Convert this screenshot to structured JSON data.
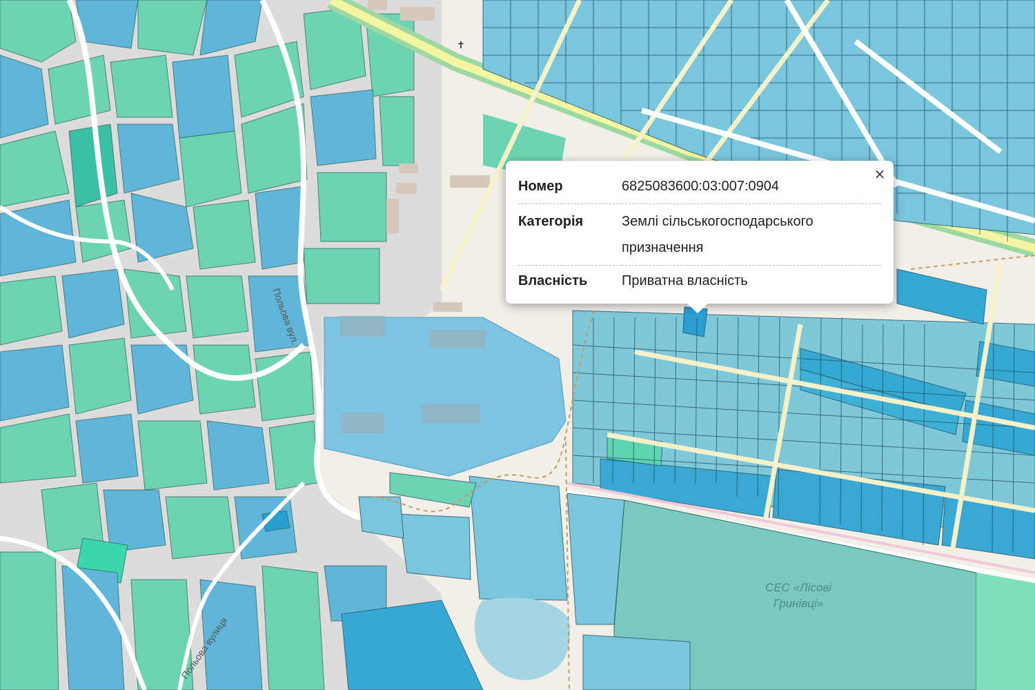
{
  "map": {
    "street_labels": [
      "Польова вул.",
      "Польова вулиця"
    ],
    "area_label": "СЕС «Лісові\nГринівці»",
    "colors": {
      "land": "#f2efe9",
      "parcel_teal": "#5fd4b0",
      "parcel_blue": "#5db9dd",
      "parcel_dark": "#2aa7d0",
      "road": "#ffffff",
      "highway": "#f7f4a1",
      "selected": "#2d9fd3"
    }
  },
  "popup": {
    "rows": [
      {
        "key": "Номер",
        "value": "6825083600:03:007:0904"
      },
      {
        "key": "Категорія",
        "value": "Землі сільськогосподарського призначення"
      },
      {
        "key": "Власність",
        "value": "Приватна власність"
      }
    ],
    "close_label": "×"
  }
}
